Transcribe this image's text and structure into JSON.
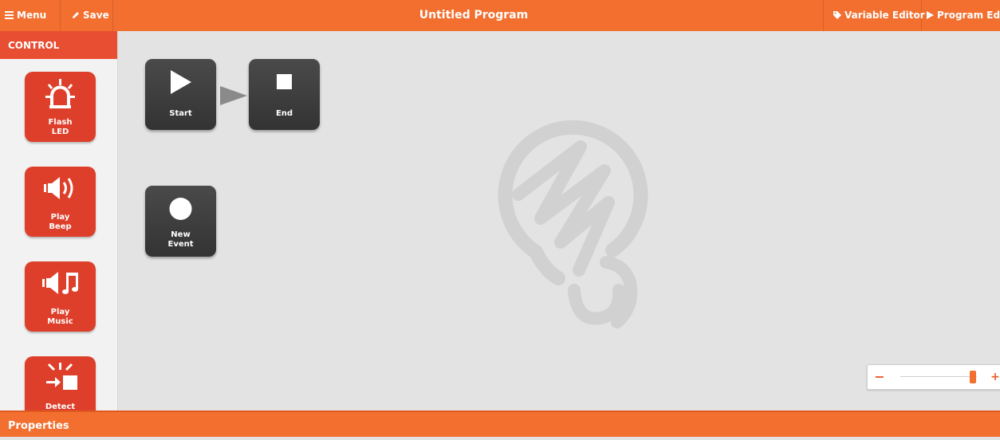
{
  "topbar": {
    "menu_label": "Menu",
    "save_label": "Save",
    "title": "Untitled Program",
    "variable_editor_label": "Variable Editor",
    "program_editor_label": "Program Edi"
  },
  "sidebar": {
    "header": "CONTROL",
    "blocks": [
      {
        "icon": "flashing-led-icon",
        "line1": "Flash",
        "line2": "LED"
      },
      {
        "icon": "speaker-beep-icon",
        "line1": "Play",
        "line2": "Beep"
      },
      {
        "icon": "speaker-music-icon",
        "line1": "Play",
        "line2": "Music"
      },
      {
        "icon": "detect-icon",
        "line1": "Detect",
        "line2": ""
      }
    ]
  },
  "canvas": {
    "nodes": [
      {
        "icon": "play-icon",
        "line1": "Start",
        "line2": ""
      },
      {
        "icon": "stop-icon",
        "line1": "End",
        "line2": ""
      },
      {
        "icon": "circle-icon",
        "line1": "New",
        "line2": "Event"
      }
    ],
    "watermark_icon": "lightbulb-logo-icon"
  },
  "zoom": {
    "minus": "−",
    "plus": "+",
    "level": 0.95
  },
  "properties_label": "Properties",
  "colors": {
    "accent": "#f26f2f",
    "block_red": "#de3f2a",
    "node_dark": "#3a3a3a"
  }
}
